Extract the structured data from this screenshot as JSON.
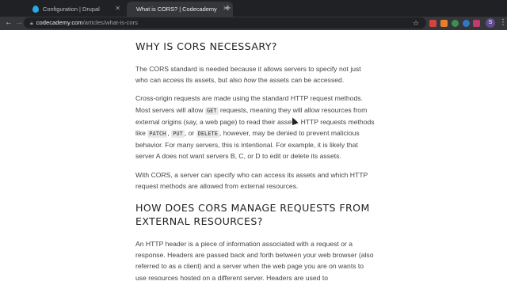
{
  "tabs": [
    {
      "title": "Configuration | Drupal",
      "favicon": "drupal-icon",
      "active": false
    },
    {
      "title": "What is CORS? | Codecademy",
      "active": true
    }
  ],
  "toolbar": {
    "url_domain": "codecademy.com",
    "url_path": "/articles/what-is-cors",
    "avatar_letter": "S",
    "extension_colors": [
      "#d0453e",
      "#e57f2e",
      "#3f8f4f",
      "#2d79c7",
      "#c23b6a",
      "#7b7f84"
    ]
  },
  "article": {
    "heading1": "WHY IS CORS NECESSARY?",
    "para1": {
      "a": "The CORS standard is needed because it allows servers to specify not just who can access its assets, but also ",
      "em": "how",
      "b": " the assets can be accessed."
    },
    "para2": {
      "a": "Cross-origin requests are made using the standard HTTP request methods. Most servers will allow ",
      "code1": "GET",
      "b": " requests, meaning they will allow resources from external origins (say, a web page) to read their assets. HTTP requests methods like ",
      "code2": "PATCH",
      "c": ", ",
      "code3": "PUT",
      "d": ", or ",
      "code4": "DELETE",
      "e": ", however, may be denied to prevent malicious behavior. For many servers, this is intentional. For example, it is likely that server A does not want servers B, C, or D to edit or delete its assets."
    },
    "para3": "With CORS, a server can specify who can access its assets and which HTTP request methods are allowed from external resources.",
    "heading2": "HOW DOES CORS MANAGE REQUESTS FROM EXTERNAL RESOURCES?",
    "para4": "An HTTP header is a piece of information associated with a request or a response. Headers are passed back and forth between your web browser (also referred to as a client) and a server when the web page you are on wants to use resources hosted on a different server. Headers are used to"
  }
}
